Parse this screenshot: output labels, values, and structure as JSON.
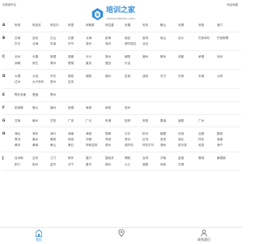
{
  "header": {
    "left_hint": "切换城市站",
    "right_hint": "网站地图",
    "logo_name": "培训之家",
    "logo_url": "www.pxhome.com"
  },
  "sections": [
    {
      "letter": "A",
      "cities": [
        "阿坝",
        "阿克苏",
        "阿拉尔",
        "阿里",
        "阿勒泰",
        "阿拉善",
        "安康",
        "安庆",
        "鞍山",
        "安顺",
        "安阳",
        "澳门"
      ]
    },
    {
      "letter": "B",
      "cities": [
        "白城",
        "百色",
        "白山",
        "白银",
        "北海",
        "蚌埠",
        "保定",
        "宝鸡",
        "保山",
        "包头",
        "巴彦淖尔",
        "巴音郭楞",
        "巴中",
        "北海",
        "本溪",
        "毕节",
        "滨州",
        "亳州",
        "博尔塔拉",
        "北京"
      ]
    },
    {
      "letter": "C",
      "cities": [
        "沧州",
        "长春",
        "常德",
        "昌都",
        "长沙",
        "常州",
        "朝阳",
        "潮州",
        "郴州",
        "成都",
        "承德",
        "池州",
        "赤峰",
        "崇左",
        "滁州",
        "楚雄",
        "重庆",
        "澄迈",
        "长治"
      ]
    },
    {
      "letter": "D",
      "cities": [
        "大理",
        "大连",
        "丹东",
        "德宏",
        "德阳",
        "德州",
        "定西",
        "迪庆",
        "东方",
        "东莞",
        "东营",
        "大同",
        "达州",
        "大兴安岭",
        "儋州",
        "定安"
      ]
    },
    {
      "letter": "E",
      "cities": [
        "鄂尔多斯",
        "恩施",
        "鄂州"
      ]
    },
    {
      "letter": "F",
      "cities": [
        "防城港",
        "佛山",
        "福州",
        "抚顺",
        "阜新",
        "阜阳",
        "抚州"
      ]
    },
    {
      "letter": "G",
      "cities": [
        "甘南",
        "赣州",
        "甘孜",
        "广安",
        "广元",
        "贵港",
        "桂林",
        "贵阳",
        "果洛",
        "固原",
        "广州"
      ]
    },
    {
      "letter": "H",
      "cities": [
        "海北",
        "海东",
        "海口",
        "海南",
        "海西",
        "邯郸",
        "汉中",
        "杭州",
        "鹤壁",
        "河池",
        "合肥",
        "鹤岗",
        "黑河",
        "衡水",
        "衡阳",
        "和田",
        "河源",
        "菏泽",
        "贺州",
        "红河",
        "淮安",
        "淮北",
        "怀化",
        "淮南",
        "黄冈",
        "黄南",
        "黄山",
        "黄石",
        "呼和浩特",
        "惠州",
        "葫芦岛",
        "呼伦贝尔",
        "湖州",
        "哈尔滨",
        "哈密",
        "海宁"
      ]
    },
    {
      "letter": "J",
      "cities": [
        "佳木斯",
        "吉安",
        "江门",
        "焦作",
        "嘉兴",
        "嘉峪关",
        "揭阳",
        "吉林",
        "济南",
        "金昌",
        "晋城",
        "景德镇",
        "荆门",
        "荆州",
        "金华",
        "济宁",
        "晋中",
        "锦州",
        "九江",
        "酒泉",
        "鸡西",
        "济源"
      ]
    }
  ],
  "bottom_nav": [
    {
      "label": "首页",
      "icon": "home-icon",
      "active": true
    },
    {
      "label": "",
      "icon": "location-icon",
      "active": false
    },
    {
      "label": "联系我们",
      "icon": "contact-icon",
      "active": false
    }
  ],
  "colors": {
    "accent": "#3a8fd9",
    "text": "#555555",
    "divider": "#f0f0f0"
  }
}
